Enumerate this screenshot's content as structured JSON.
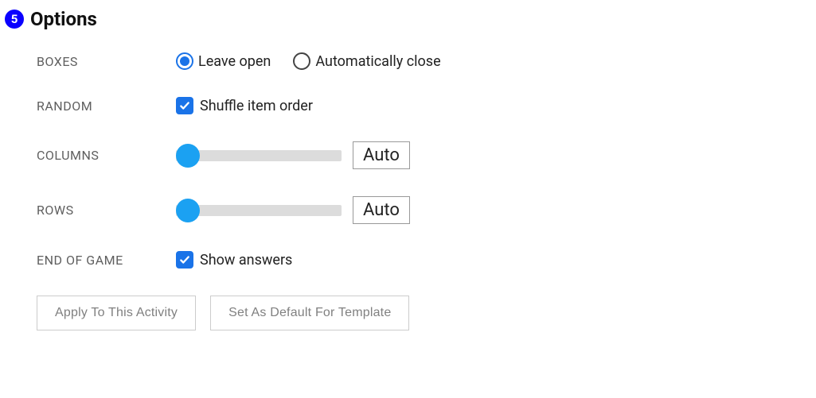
{
  "section": {
    "step_number": "5",
    "title": "Options"
  },
  "rows": {
    "boxes": {
      "label": "BOXES",
      "options": {
        "leave_open": "Leave open",
        "auto_close": "Automatically close"
      },
      "selected": "leave_open"
    },
    "random": {
      "label": "RANDOM",
      "checkbox_label": "Shuffle item order",
      "checked": true
    },
    "columns": {
      "label": "COLUMNS",
      "value": "Auto"
    },
    "rows_opt": {
      "label": "ROWS",
      "value": "Auto"
    },
    "end_of_game": {
      "label": "END OF GAME",
      "checkbox_label": "Show answers",
      "checked": true
    }
  },
  "buttons": {
    "apply": "Apply To This Activity",
    "set_default": "Set As Default For Template"
  }
}
